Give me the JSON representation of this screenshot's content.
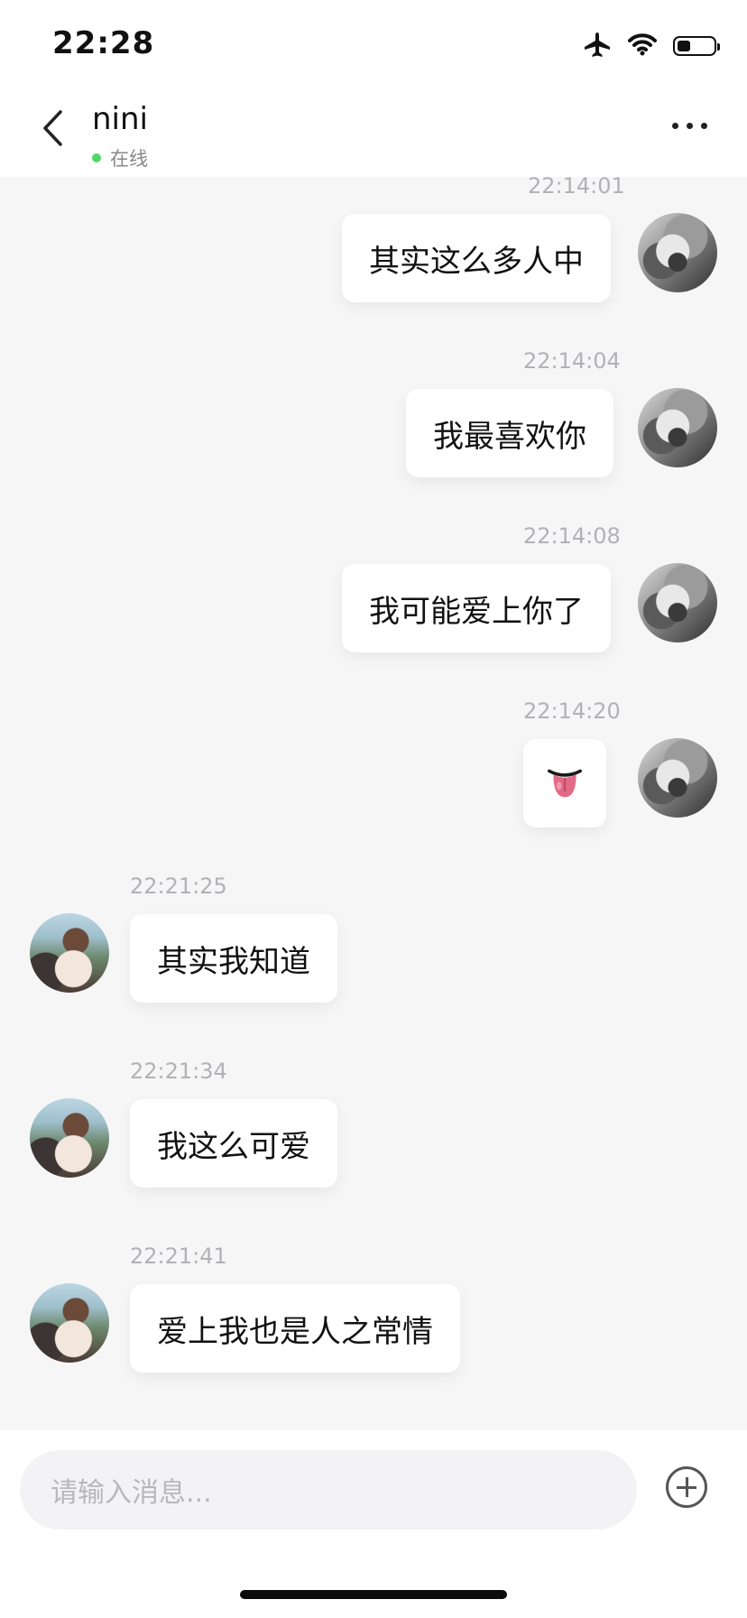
{
  "status_bar": {
    "time": "22:28"
  },
  "header": {
    "title": "nini",
    "presence": "在线"
  },
  "messages": [
    {
      "side": "me",
      "time": "22:14:01",
      "text": "其实这么多人中"
    },
    {
      "side": "me",
      "time": "22:14:04",
      "text": "我最喜欢你"
    },
    {
      "side": "me",
      "time": "22:14:08",
      "text": "我可能爱上你了"
    },
    {
      "side": "me",
      "time": "22:14:20",
      "emoji": "tongue-emoji"
    },
    {
      "side": "them",
      "time": "22:21:25",
      "text": "其实我知道"
    },
    {
      "side": "them",
      "time": "22:21:34",
      "text": "我这么可爱"
    },
    {
      "side": "them",
      "time": "22:21:41",
      "text": "爱上我也是人之常情"
    }
  ],
  "composer": {
    "placeholder": "请输入消息..."
  },
  "icons": {
    "back": "chevron-left-icon",
    "more": "more-dots-icon",
    "add": "plus-circle-icon",
    "airplane": "airplane-icon",
    "wifi": "wifi-icon",
    "battery": "battery-icon"
  },
  "colors": {
    "online": "#4cd964",
    "background": "#f6f6f7",
    "bubble": "#ffffff"
  }
}
